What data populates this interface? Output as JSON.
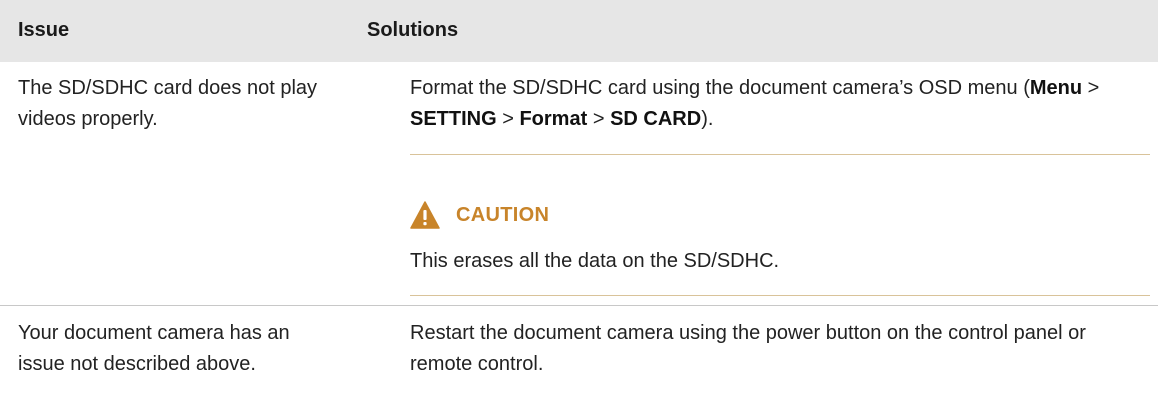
{
  "table": {
    "headers": {
      "issue": "Issue",
      "solutions": "Solutions"
    },
    "rows": [
      {
        "issue": "The SD/SDHC card does not play videos properly.",
        "solution_parts": {
          "pre": "Format the SD/SDHC card using the document camera’s OSD menu (",
          "menu": "Menu",
          "sep1": " > ",
          "setting": "SETTING",
          "sep2": " > ",
          "format": "Format",
          "sep3": " > ",
          "sdcard": "SD CARD",
          "post": ")."
        },
        "caution": {
          "title": "CAUTION",
          "text": "This erases all the data on the SD/SDHC."
        }
      },
      {
        "issue": "Your document camera has an issue not described above.",
        "solution": "Restart the document camera using the power button on the control panel or remote control."
      }
    ]
  },
  "colors": {
    "header_bg": "#e6e6e6",
    "caution_accent": "#c8842a",
    "caution_rule": "#d9c39a",
    "row_divider": "#c8c8c8"
  },
  "icons": {
    "caution": "warning-triangle-icon"
  }
}
